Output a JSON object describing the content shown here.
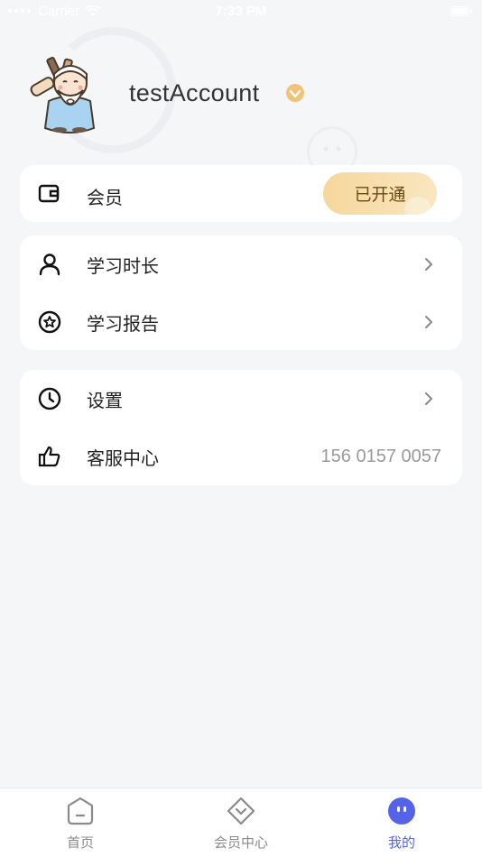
{
  "status_bar": {
    "carrier": "Carrier",
    "time": "7:33 PM"
  },
  "profile": {
    "username": "testAccount"
  },
  "member_card": {
    "label": "会员",
    "status_button": "已开通"
  },
  "study_card": {
    "items": [
      {
        "label": "学习时长"
      },
      {
        "label": "学习报告"
      }
    ]
  },
  "misc_card": {
    "settings_label": "设置",
    "service_label": "客服中心",
    "service_phone": "156 0157 0057"
  },
  "tab_bar": {
    "tabs": [
      {
        "label": "首页"
      },
      {
        "label": "会员中心"
      },
      {
        "label": "我的"
      }
    ],
    "active_index": 2,
    "active_color": "#5563e8",
    "inactive_color": "#8a8a8a"
  },
  "colors": {
    "background": "#f5f6f8",
    "gold_gradient_start": "#f6d79c",
    "gold_gradient_end": "#f9e6c0"
  },
  "icons": {
    "member": "wallet-icon",
    "study_time": "person-icon",
    "study_report": "star-badge-icon",
    "settings": "clock-icon",
    "service": "thumbs-up-icon",
    "vip": "vip-diamond-icon",
    "chevron": "chevron-right-icon"
  }
}
